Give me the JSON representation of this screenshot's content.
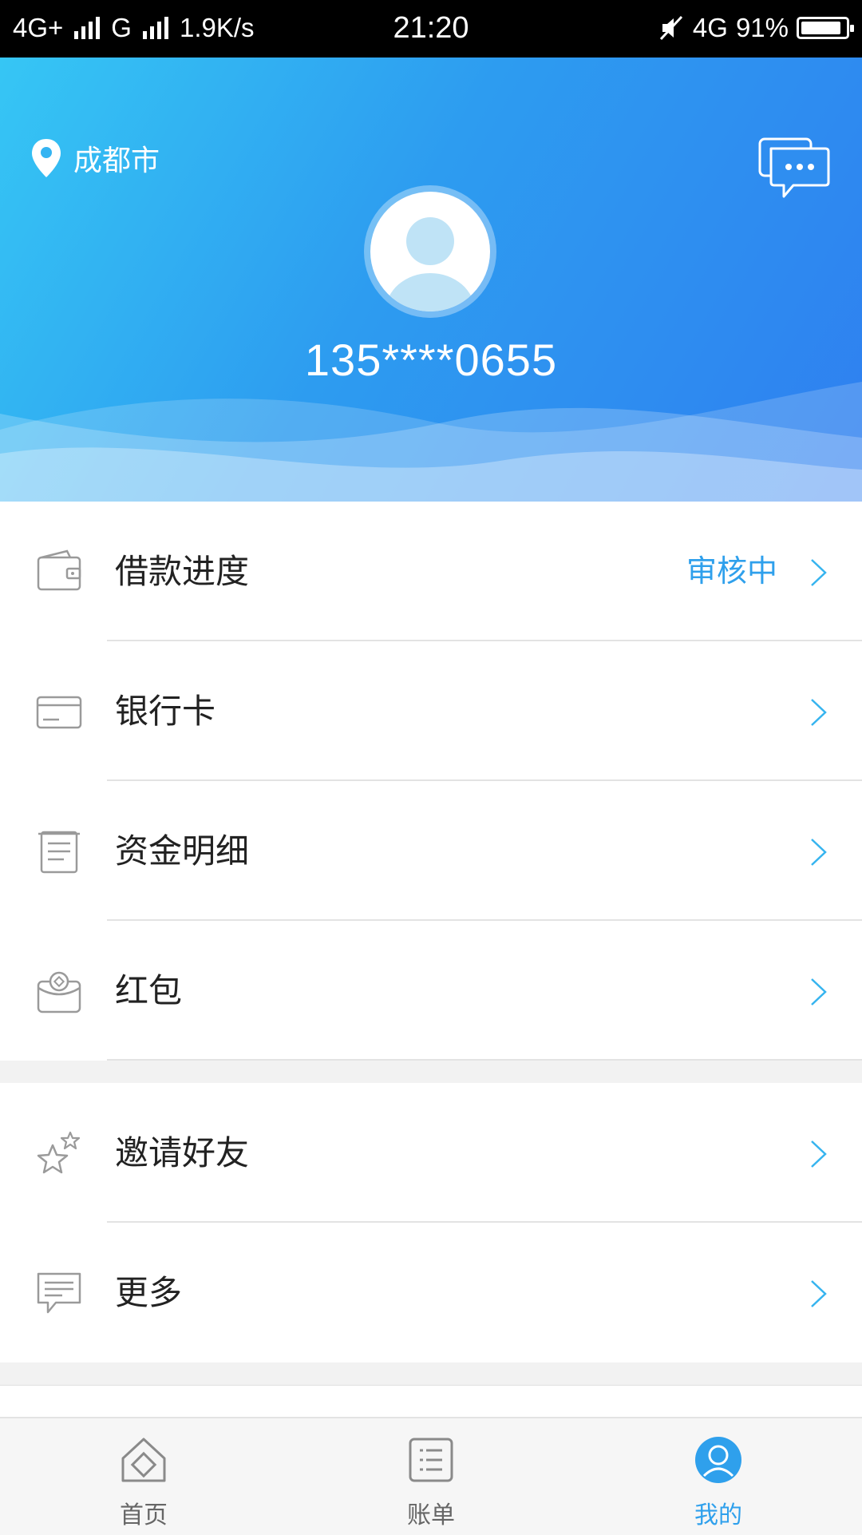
{
  "status_bar": {
    "network_left": "4G+",
    "network_mid": "G",
    "speed": "1.9K/s",
    "time": "21:20",
    "network_right": "4G",
    "battery_percent": "91%",
    "battery_level": 0.91
  },
  "header": {
    "location": "成都市",
    "phone": "135****0655",
    "icons": {
      "location": "location-pin-icon",
      "message": "message-bubbles-icon",
      "avatar": "default-avatar-icon"
    },
    "colors": {
      "gradient_start": "#36c6f4",
      "gradient_end": "#2f7ff0"
    }
  },
  "menu": {
    "group1": [
      {
        "label": "借款进度",
        "status": "审核中",
        "icon": "wallet-icon"
      },
      {
        "label": "银行卡",
        "status": "",
        "icon": "bank-card-icon"
      },
      {
        "label": "资金明细",
        "status": "",
        "icon": "ledger-icon"
      },
      {
        "label": "红包",
        "status": "",
        "icon": "red-envelope-icon"
      }
    ],
    "group2": [
      {
        "label": "邀请好友",
        "status": "",
        "icon": "invite-stars-icon"
      },
      {
        "label": "更多",
        "status": "",
        "icon": "more-message-icon"
      }
    ]
  },
  "tabbar": {
    "tabs": [
      {
        "label": "首页",
        "icon": "home-icon",
        "active": false
      },
      {
        "label": "账单",
        "icon": "bill-list-icon",
        "active": false
      },
      {
        "label": "我的",
        "icon": "profile-icon",
        "active": true
      }
    ],
    "accent": "#2fa0ec"
  }
}
